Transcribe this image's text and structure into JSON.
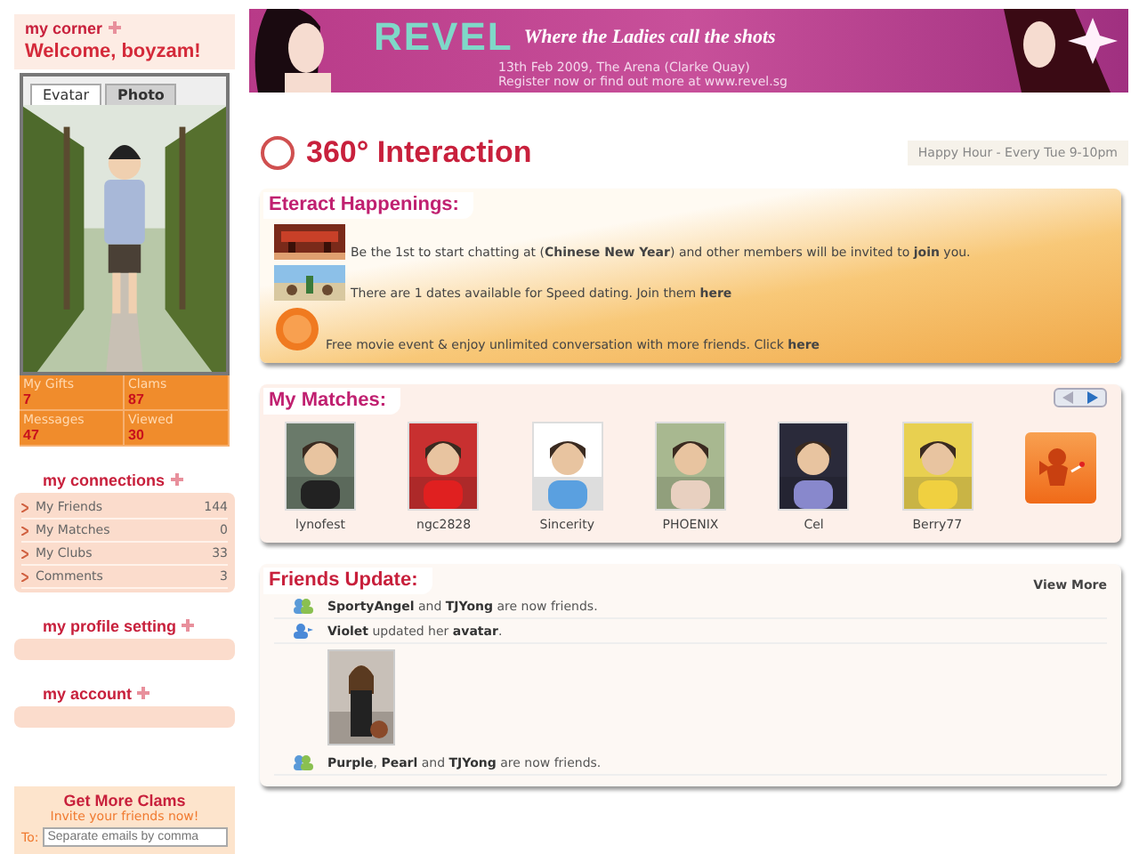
{
  "sidebar": {
    "corner_title": "my corner",
    "welcome": "Welcome, boyzam!",
    "avatar_tabs": [
      {
        "label": "Evatar",
        "selected": true
      },
      {
        "label": "Photo",
        "selected": false
      }
    ],
    "stats": [
      {
        "label": "My Gifts",
        "value": "7"
      },
      {
        "label": "Clams",
        "value": "87"
      },
      {
        "label": "Messages",
        "value": "47"
      },
      {
        "label": "Viewed",
        "value": "30"
      }
    ],
    "connections": {
      "title": "my connections",
      "items": [
        {
          "label": "My Friends",
          "count": "144"
        },
        {
          "label": "My Matches",
          "count": "0"
        },
        {
          "label": "My Clubs",
          "count": "33"
        },
        {
          "label": "Comments",
          "count": "3"
        }
      ]
    },
    "sections": [
      {
        "title": "my profile setting"
      },
      {
        "title": "my account"
      }
    ],
    "invite": {
      "title": "Get More Clams",
      "subtitle": "Invite your friends now!",
      "to_label": "To:",
      "placeholder": "Separate emails by comma"
    }
  },
  "banner": {
    "logo": "REVEL",
    "tagline": "Where the Ladies call the shots",
    "date_line": "13th Feb 2009, The Arena (Clarke Quay)",
    "register_line": "Register now or find out more at www.revel.sg"
  },
  "header": {
    "title": "360° Interaction",
    "happy_hour": "Happy Hour - Every Tue 9-10pm"
  },
  "happenings": {
    "title": "Eteract Happenings:",
    "items": [
      {
        "kind": "room",
        "text": "Be the 1st to start chatting at (**Chinese New Year**) and other members will be invited to **join** you."
      },
      {
        "kind": "dating",
        "text": "There are 1 dates available for Speed dating. Join them **here**"
      },
      {
        "kind": "badge",
        "text": "Free movie event & enjoy unlimited conversation with more friends. Click **here**"
      }
    ]
  },
  "matches": {
    "title": "My Matches:",
    "people": [
      {
        "name": "lynofest"
      },
      {
        "name": "ngc2828"
      },
      {
        "name": "Sincerity"
      },
      {
        "name": "PHOENIX"
      },
      {
        "name": "Cel"
      },
      {
        "name": "Berry77"
      }
    ]
  },
  "friends_update": {
    "title": "Friends Update:",
    "view_more": "View More",
    "items": [
      {
        "kind": "friends",
        "text": "**SportyAngel** and **TJYong** are now friends."
      },
      {
        "kind": "avatar",
        "text": "**Violet** updated her **avatar**."
      },
      {
        "kind": "friends",
        "text": "**Purple**, **Pearl** and **TJYong** are now friends."
      }
    ]
  }
}
